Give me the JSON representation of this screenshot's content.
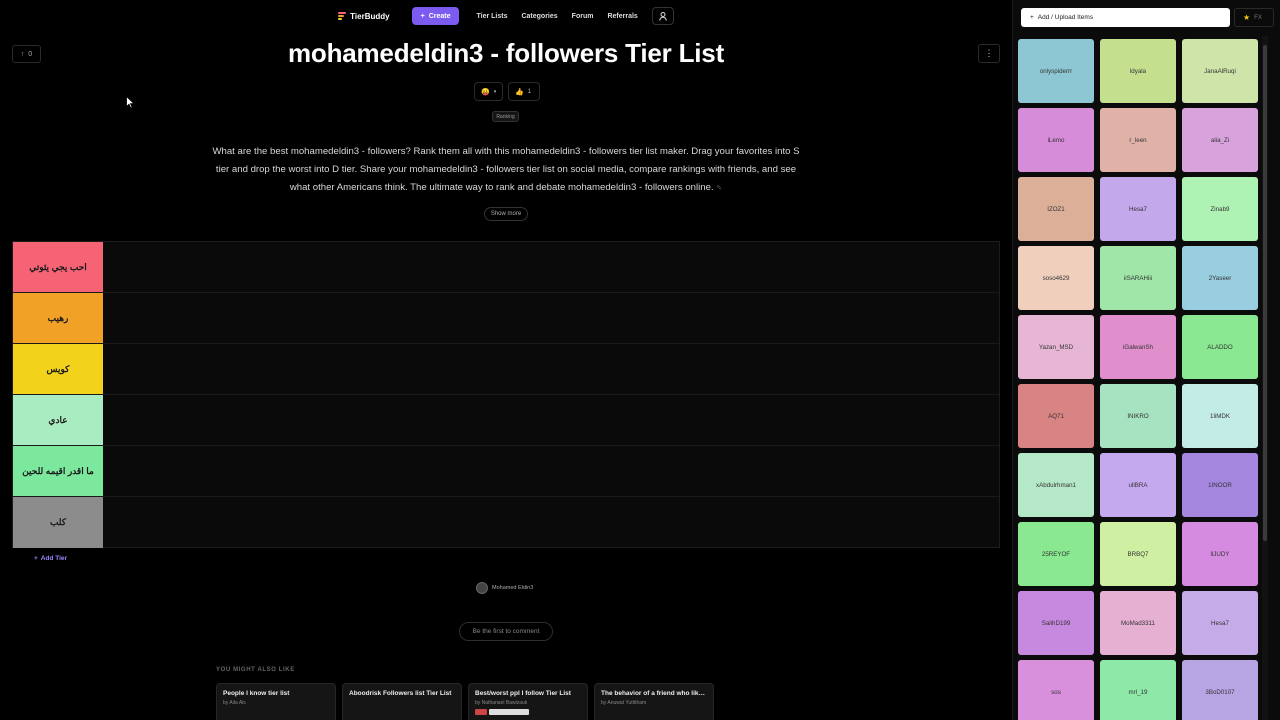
{
  "nav": {
    "logo_text": "TierBuddy",
    "create_label": "Create",
    "links": [
      "Tier Lists",
      "Categories",
      "Forum",
      "Referrals"
    ]
  },
  "header": {
    "upvote_count": "0",
    "title": "mohamedeldin3 - followers Tier List",
    "like_count": "1",
    "tag": "Ranking",
    "description": "What are the best mohamedeldin3 - followers? Rank them all with this mohamedeldin3 - followers tier list maker. Drag your favorites into S tier and drop the worst into D tier. Share your mohamedeldin3 - followers tier list on social media, compare rankings with friends, and see what other Americans think. The ultimate way to rank and debate mohamedeldin3 - followers online.",
    "show_more": "Show more"
  },
  "tiers": [
    {
      "label": "احب يجي يثوتي",
      "color": "#f56375"
    },
    {
      "label": "رهيب",
      "color": "#f0a126"
    },
    {
      "label": "كويس",
      "color": "#f2d21b"
    },
    {
      "label": "عادي",
      "color": "#a9ecc2"
    },
    {
      "label": "ما اقدر اقيمه للحين",
      "color": "#7be89e"
    },
    {
      "label": "كلب",
      "color": "#8c8c8c"
    }
  ],
  "add_tier": "Add Tier",
  "creator": "Mohamed Eldin3",
  "comment_prompt": "Be the first to comment",
  "also_like": {
    "heading": "YOU MIGHT ALSO LIKE",
    "cards": [
      {
        "title": "People I know tier list",
        "by": "by Aila Als"
      },
      {
        "title": "Aboodrisk Followers list Tier List",
        "by": ""
      },
      {
        "title": "Best/worst ppl I follow Tier List",
        "by": "by Nathanael Bawizauk"
      },
      {
        "title": "The behavior of a friend who likes to f...",
        "by": "by Anuwat Yuttitham"
      }
    ]
  },
  "panel": {
    "upload_label": "Add / Upload Items",
    "fx_label": "FX",
    "items": [
      {
        "name": "onlyspiderrr",
        "color": "#8ec7d4"
      },
      {
        "name": "ldyala",
        "color": "#c4e08e"
      },
      {
        "name": "JanaAlRuqi",
        "color": "#cfe4a9"
      },
      {
        "name": "iLemo",
        "color": "#d68cd8"
      },
      {
        "name": "r_leen",
        "color": "#e0b1a6"
      },
      {
        "name": "alia_Zi",
        "color": "#d8a3dc"
      },
      {
        "name": "IZOZ1",
        "color": "#dcaf98"
      },
      {
        "name": "Hesa7",
        "color": "#c3a8ec"
      },
      {
        "name": "Zinab9",
        "color": "#aef3b4"
      },
      {
        "name": "soso4629",
        "color": "#f0d0bd"
      },
      {
        "name": "iiSARAHiii",
        "color": "#9fe6a8"
      },
      {
        "name": "2Yaseer",
        "color": "#99cde0"
      },
      {
        "name": "Yazan_MSD",
        "color": "#e6b6d4"
      },
      {
        "name": "iGalwanSh",
        "color": "#e08fcc"
      },
      {
        "name": "ALADDO",
        "color": "#8ae892"
      },
      {
        "name": "AQ71",
        "color": "#d88484"
      },
      {
        "name": "INIKRO",
        "color": "#a6e3c0"
      },
      {
        "name": "1liMDK",
        "color": "#c3ece6"
      },
      {
        "name": "xAbdulrhman1",
        "color": "#b5e8c6"
      },
      {
        "name": "ullBRA",
        "color": "#c5a9ef"
      },
      {
        "name": "1INOOR",
        "color": "#a687e0"
      },
      {
        "name": "25REYOF",
        "color": "#8ae890"
      },
      {
        "name": "BRBQ7",
        "color": "#cff0a3"
      },
      {
        "name": "llJUDY",
        "color": "#d58ce0"
      },
      {
        "name": "SalihD199",
        "color": "#c789e0"
      },
      {
        "name": "MoMad3311",
        "color": "#e6b0d2"
      },
      {
        "name": "Hesa7",
        "color": "#c5ace8"
      },
      {
        "name": "sos",
        "color": "#d88fdc"
      },
      {
        "name": "mrl_19",
        "color": "#8ee8a8"
      },
      {
        "name": "3BoD0107",
        "color": "#b6a4e3"
      }
    ]
  }
}
